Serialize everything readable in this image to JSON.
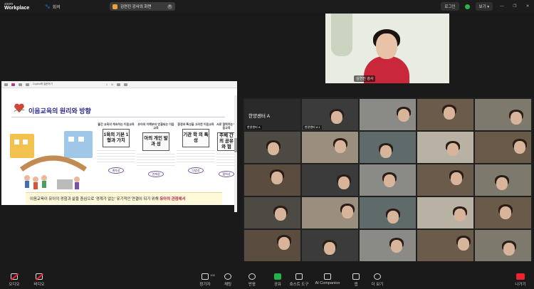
{
  "app": {
    "brand_top": "zoom",
    "brand_bottom": "Workplace",
    "home_label": "회의"
  },
  "meeting": {
    "tab_title": "김연진 강사의 화면"
  },
  "window_controls": {
    "login_label": "로그인",
    "view_label": "보기"
  },
  "share": {
    "toolbar_items": [
      "Copilot에 질문하기",
      "1",
      "/4"
    ],
    "slide_title": "이음교육의 원리와 방향",
    "columns": [
      {
        "header": "출간 교육의 계속하는 이음교육",
        "card": "1육의 기본 1형과 가치",
        "badge": "계속성"
      },
      {
        "header": "유아의 이해부터 연결되는 이음교육",
        "card": "아의 개인 발과 성",
        "badge": "연계성"
      },
      {
        "header": "환경과 특성을 고려한 이음교육",
        "card": "기관 학 의 특성",
        "badge": "다양성"
      },
      {
        "header": "서로 협력하는 이음교육",
        "card": "주체 간의 공유와 협",
        "badge": "협력성"
      }
    ],
    "footer_text": "이음교육이 유아의 경험과 삶을 중심으로 '경계가 없는' 유기적인 연결이 되기 위해",
    "footer_emphasis": "유아의 관점에서"
  },
  "speaker": {
    "name": "김연진 강사"
  },
  "gallery": {
    "featured_name": "한양센터 A",
    "tiles": [
      "한양센터 A",
      "한양센터 A 1",
      "",
      "",
      "",
      "",
      "",
      "",
      "",
      "",
      "",
      "",
      "",
      "",
      "",
      "",
      "",
      "",
      "",
      "",
      "",
      "",
      "",
      "",
      ""
    ]
  },
  "toolbar": {
    "buttons": [
      {
        "label": "오디오",
        "icon": "microphone-muted-icon"
      },
      {
        "label": "비디오",
        "icon": "camera-muted-icon"
      },
      {
        "label": "참가자",
        "icon": "participants-icon",
        "count": "102"
      },
      {
        "label": "채팅",
        "icon": "chat-icon"
      },
      {
        "label": "반응",
        "icon": "heart-icon"
      },
      {
        "label": "공유",
        "icon": "share-icon"
      },
      {
        "label": "호스트 도구",
        "icon": "shield-icon"
      },
      {
        "label": "AI Companion",
        "icon": "sparkle-icon"
      },
      {
        "label": "앱",
        "icon": "apps-icon"
      },
      {
        "label": "더 보기",
        "icon": "more-icon"
      }
    ],
    "leave_label": "나가기"
  }
}
